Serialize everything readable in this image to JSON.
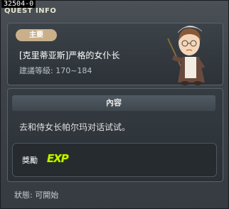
{
  "window": {
    "quest_id": "32504-0",
    "title": "QUEST INFO"
  },
  "quest": {
    "badge": "主要",
    "name": "[克里蒂亚斯]严格的女仆长",
    "level": "建議等級: 170~184"
  },
  "content": {
    "header": "內容",
    "text": "去和侍女长帕尔玛对话试试。"
  },
  "reward": {
    "label": "獎勵",
    "exp_text": "EXP",
    "exp_icon_color": "#c8f000"
  },
  "status": "狀態: 可開始",
  "colors": {
    "badge_bg": "#c9b08a",
    "title_text": "#e8e4d0",
    "accent": "#d6b16a"
  }
}
